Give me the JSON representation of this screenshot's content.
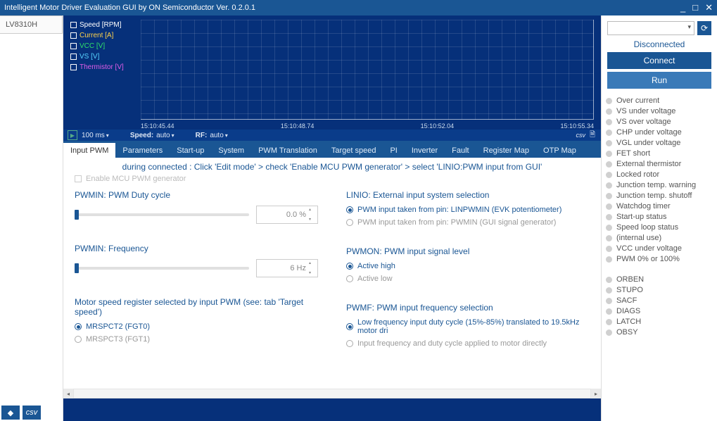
{
  "title": "Intelligent Motor Driver Evaluation GUI by ON Semiconductor Ver. 0.2.0.1",
  "device": "LV8310H",
  "legend": {
    "speed": {
      "label": "Speed [RPM]",
      "color": "#ffffff"
    },
    "current": {
      "label": "Current [A]",
      "color": "#ffd24a"
    },
    "vcc": {
      "label": "VCC [V]",
      "color": "#2fe06a"
    },
    "vs": {
      "label": "VS [V]",
      "color": "#57d3ff"
    },
    "thermistor": {
      "label": "Thermistor [V]",
      "color": "#e05ce8"
    }
  },
  "xticks": [
    "15:10:45.44",
    "15:10:48.74",
    "15:10:52.04",
    "15:10:55.34"
  ],
  "chartFooter": {
    "interval": "100 ms",
    "speedLabel": "Speed:",
    "speedVal": "auto",
    "rfLabel": "RF:",
    "rfVal": "auto",
    "csv": "csv"
  },
  "tabs": [
    "Input PWM",
    "Parameters",
    "Start-up",
    "System",
    "PWM Translation",
    "Target speed",
    "PI",
    "Inverter",
    "Fault",
    "Register Map",
    "OTP Map"
  ],
  "hint": "during connected : Click 'Edit mode'  >  check 'Enable MCU PWM generator'  >  select 'LINIO:PWM input from GUI'",
  "enableLabel": "Enable MCU PWM generator",
  "left": {
    "duty": {
      "title": "PWMIN: PWM Duty cycle",
      "value": "0.0 %"
    },
    "freq": {
      "title": "PWMIN: Frequency",
      "value": "6 Hz"
    },
    "motor": {
      "title": "Motor speed register selected by input PWM (see: tab 'Target speed')",
      "opt1": "MRSPCT2  (FGT0)",
      "opt2": "MRSPCT3  (FGT1)"
    }
  },
  "right": {
    "linio": {
      "title": "LINIO: External input system selection",
      "opt1": "PWM input taken from pin: LINPWMIN (EVK potentiometer)",
      "opt2": "PWM input taken from pin: PWMIN (GUI signal generator)"
    },
    "pwmon": {
      "title": "PWMON: PWM input signal level",
      "opt1": "Active high",
      "opt2": "Active low"
    },
    "pwmf": {
      "title": "PWMF: PWM input frequency selection",
      "opt1": "Low frequency input duty cycle (15%-85%) translated to 19.5kHz motor dri",
      "opt2": "Input frequency and duty cycle applied to motor directly"
    }
  },
  "conn": {
    "status": "Disconnected",
    "connect": "Connect",
    "run": "Run"
  },
  "statusA": [
    "Over current",
    "VS under voltage",
    "VS over voltage",
    "CHP under voltage",
    "VGL under voltage",
    "FET short",
    "External thermistor",
    "Locked rotor",
    "Junction temp. warning",
    "Junction temp. shutoff",
    "Watchdog timer",
    "Start-up status",
    "Speed loop status",
    "(internal use)",
    "VCC under voltage",
    "PWM 0% or 100%"
  ],
  "statusB": [
    "ORBEN",
    "STUPO",
    "SACF",
    "DIAGS",
    "LATCH",
    "OBSY"
  ]
}
